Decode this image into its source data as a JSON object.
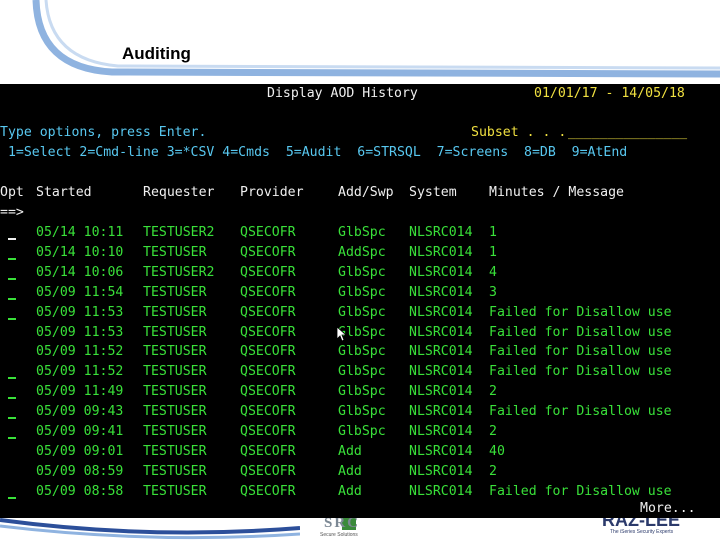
{
  "slide": {
    "title": "Auditing"
  },
  "screen": {
    "title": "Display AOD History",
    "date_range": "01/01/17 - 14/05/18",
    "instructions": "Type options, press Enter.",
    "subset_label": "Subset . . .",
    "options_line": " 1=Select 2=Cmd-line 3=*CSV 4=Cmds  5=Audit  6=STRSQL  7=Screens  8=DB  9=AtEnd",
    "headers": {
      "opt": "Opt",
      "started": "Started",
      "requester": "Requester",
      "provider": "Provider",
      "addswp": "Add/Swp",
      "system": "System",
      "message": "Minutes / Message"
    },
    "command_prompt": "==>",
    "more": "More...",
    "rows": [
      {
        "started": "05/14 10:11",
        "requester": "TESTUSER2",
        "provider": "QSECOFR",
        "addswp": "GlbSpc",
        "system": "NLSRC014",
        "message": "1",
        "opt": "_"
      },
      {
        "started": "05/14 10:10",
        "requester": "TESTUSER",
        "provider": "QSECOFR",
        "addswp": "AddSpc",
        "system": "NLSRC014",
        "message": "1",
        "opt": "_"
      },
      {
        "started": "05/14 10:06",
        "requester": "TESTUSER2",
        "provider": "QSECOFR",
        "addswp": "GlbSpc",
        "system": "NLSRC014",
        "message": "4",
        "opt": "_"
      },
      {
        "started": "05/09 11:54",
        "requester": "TESTUSER",
        "provider": "QSECOFR",
        "addswp": "GlbSpc",
        "system": "NLSRC014",
        "message": "3",
        "opt": "_"
      },
      {
        "started": "05/09 11:53",
        "requester": "TESTUSER",
        "provider": "QSECOFR",
        "addswp": "GlbSpc",
        "system": "NLSRC014",
        "message": "Failed for Disallow use",
        "opt": "_"
      },
      {
        "started": "05/09 11:53",
        "requester": "TESTUSER",
        "provider": "QSECOFR",
        "addswp": "GlbSpc",
        "system": "NLSRC014",
        "message": "Failed for Disallow use",
        "opt": ""
      },
      {
        "started": "05/09 11:52",
        "requester": "TESTUSER",
        "provider": "QSECOFR",
        "addswp": "GlbSpc",
        "system": "NLSRC014",
        "message": "Failed for Disallow use",
        "opt": ""
      },
      {
        "started": "05/09 11:52",
        "requester": "TESTUSER",
        "provider": "QSECOFR",
        "addswp": "GlbSpc",
        "system": "NLSRC014",
        "message": "Failed for Disallow use",
        "opt": "_"
      },
      {
        "started": "05/09 11:49",
        "requester": "TESTUSER",
        "provider": "QSECOFR",
        "addswp": "GlbSpc",
        "system": "NLSRC014",
        "message": "2",
        "opt": "_"
      },
      {
        "started": "05/09 09:43",
        "requester": "TESTUSER",
        "provider": "QSECOFR",
        "addswp": "GlbSpc",
        "system": "NLSRC014",
        "message": "Failed for Disallow use",
        "opt": "_"
      },
      {
        "started": "05/09 09:41",
        "requester": "TESTUSER",
        "provider": "QSECOFR",
        "addswp": "GlbSpc",
        "system": "NLSRC014",
        "message": "2",
        "opt": "_"
      },
      {
        "started": "05/09 09:01",
        "requester": "TESTUSER",
        "provider": "QSECOFR",
        "addswp": "Add",
        "system": "NLSRC014",
        "message": "40",
        "opt": ""
      },
      {
        "started": "05/09 08:59",
        "requester": "TESTUSER",
        "provider": "QSECOFR",
        "addswp": "Add",
        "system": "NLSRC014",
        "message": "2",
        "opt": ""
      },
      {
        "started": "05/09 08:58",
        "requester": "TESTUSER",
        "provider": "QSECOFR",
        "addswp": "Add",
        "system": "NLSRC014",
        "message": "Failed for Disallow use",
        "opt": "_"
      }
    ]
  },
  "footer": {
    "logo_left": "SRC",
    "logo_left_sub": "Secure Solutions",
    "logo_right": "RAZ-LEE",
    "logo_right_sub": "The iSeries Security Experts"
  }
}
